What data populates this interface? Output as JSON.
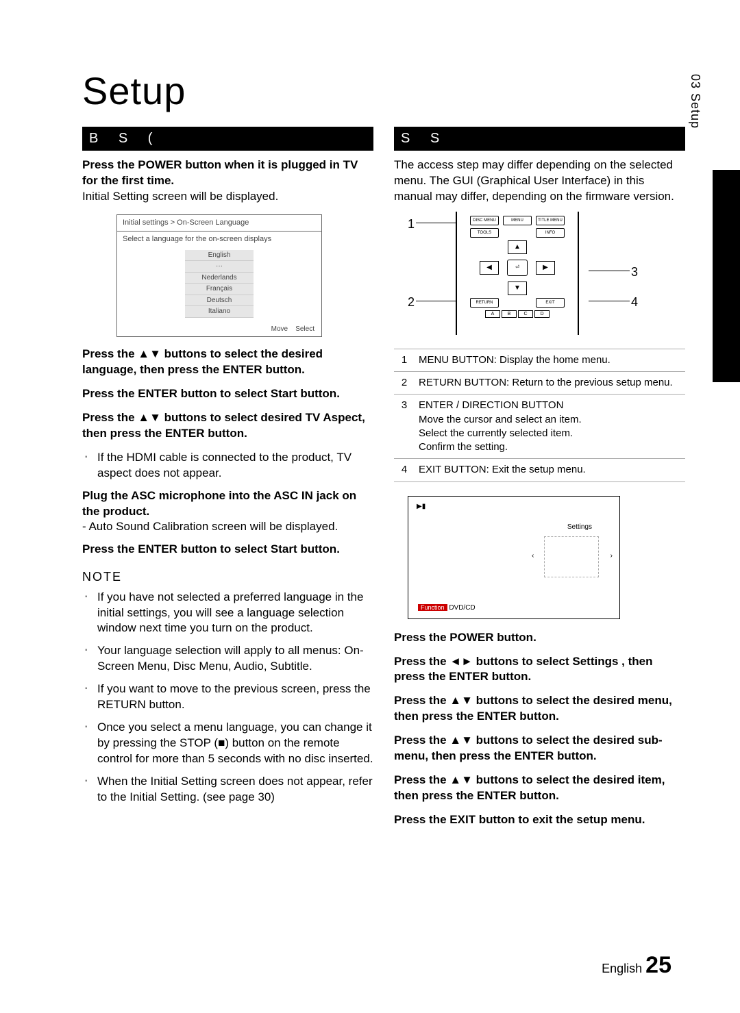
{
  "side_tab": "03  Setup",
  "title": "Setup",
  "left": {
    "bar": "B      S           (",
    "intro1": "Press the POWER button when it is plugged in TV for the ﬁrst time.",
    "intro2": "Initial Setting screen will be displayed.",
    "screen": {
      "breadcrumb": "Initial settings > On-Screen Language",
      "prompt": "Select a language for the on-screen displays",
      "langs": [
        "English",
        "···",
        "Nederlands",
        "Français",
        "Deutsch",
        "Italiano"
      ],
      "footer_move": "Move",
      "footer_select": "Select"
    },
    "step2": "Press the ▲▼ buttons to select the desired language, then press the ENTER button.",
    "step3": "Press the ENTER button to select Start button.",
    "step4": "Press the ▲▼ buttons to select desired TV Aspect, then press the ENTER button.",
    "step4_sub": "If the HDMI cable is connected to the product, TV aspect does not appear.",
    "step5a": "Plug the ASC microphone into the ASC IN jack on the product.",
    "step5b": "- Auto Sound Calibration screen will be displayed.",
    "step6": "Press the ENTER button to select Start button.",
    "note_label": "NOTE",
    "notes": [
      "If you have not selected a preferred language in the initial settings, you will see a language selection window next time you turn on the product.",
      "Your language selection will apply to all menus: On-Screen Menu, Disc Menu, Audio, Subtitle.",
      "If you want to move to the previous screen, press the RETURN button.",
      "Once you select a menu language, you can change it by pressing the STOP (■) button on the remote control for more than 5 seconds with no disc inserted.",
      "When the Initial Setting screen does not appear, refer to the Initial Setting. (see page 30)"
    ]
  },
  "right": {
    "bar": "S                    S",
    "intro": "The access step may differ depending on the selected menu. The GUI (Graphical User Interface) in this manual may differ, depending on the ﬁrmware version.",
    "remote": {
      "disc_menu": "DISC MENU",
      "menu": "MENU",
      "title_menu": "TITLE MENU",
      "tools": "TOOLS",
      "info": "INFO",
      "return": "RETURN",
      "exit": "EXIT",
      "abcd": [
        "A",
        "B",
        "C",
        "D"
      ]
    },
    "callouts": {
      "c1": "1",
      "c2": "2",
      "c3": "3",
      "c4": "4"
    },
    "table": [
      {
        "n": "1",
        "t": "MENU BUTTON: Display the home menu."
      },
      {
        "n": "2",
        "t": "RETURN BUTTON: Return to the previous setup menu."
      },
      {
        "n": "3",
        "t": "ENTER / DIRECTION BUTTON\nMove the cursor and select an item.\nSelect the currently selected item.\nConﬁrm the setting."
      },
      {
        "n": "4",
        "t": "EXIT BUTTON: Exit the setup menu."
      }
    ],
    "tv": {
      "play": "▶▮",
      "settings": "Settings",
      "func_label": "Function",
      "func_val": "DVD/CD"
    },
    "steps": [
      "Press the POWER button.",
      "Press the ◄► buttons to select Settings , then press the ENTER button.",
      "Press the ▲▼ buttons to select the desired menu, then press the ENTER button.",
      "Press the ▲▼ buttons to select the desired sub-menu, then press the ENTER button.",
      "Press the ▲▼ buttons to select the desired item, then press the ENTER button.",
      "Press the EXIT button to exit the setup menu."
    ]
  },
  "footer": {
    "lang": "English",
    "page": "25"
  }
}
